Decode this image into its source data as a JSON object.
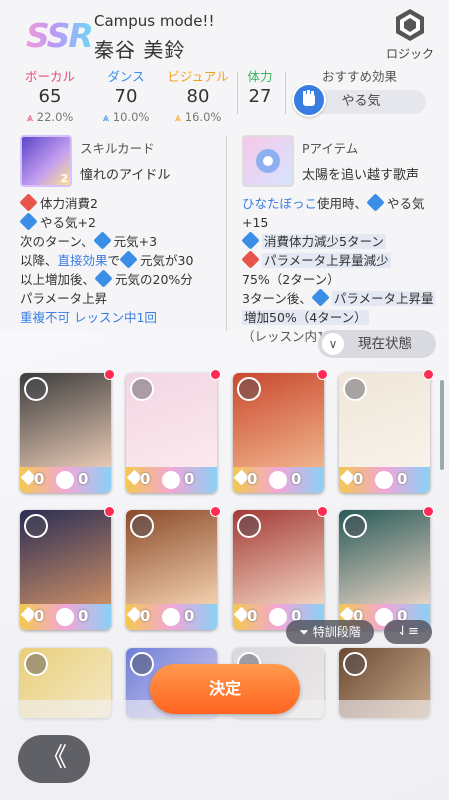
{
  "header": {
    "rarity": "SSR",
    "mode": "Campus mode!!",
    "name": "秦谷 美鈴",
    "logic_label": "ロジック"
  },
  "stats": [
    {
      "title": "ボーカル",
      "value": "65",
      "bonus": "22.0%",
      "color": "#e84a7a"
    },
    {
      "title": "ダンス",
      "value": "70",
      "bonus": "10.0%",
      "color": "#3a8ee6"
    },
    {
      "title": "ビジュアル",
      "value": "80",
      "bonus": "16.0%",
      "color": "#f2a21c"
    }
  ],
  "stamina": {
    "title": "体力",
    "value": "27",
    "color": "#3cb45a"
  },
  "recommended": {
    "title": "おすすめ効果",
    "value": "やる気"
  },
  "skill_card": {
    "section": "スキルカード",
    "name": "憧れのアイドル",
    "badge": "2",
    "lines": {
      "l1": "体力消費2",
      "l2": "やる気+2",
      "l3a": "次のターン、",
      "l3b": "元気+3",
      "l4a": "以降、",
      "l4b": "直接効果",
      "l4c": "で",
      "l4d": "元気が30",
      "l5a": "以上増加後、",
      "l5b": "元気の20%分",
      "l6": "パラメータ上昇",
      "l7": "重複不可 レッスン中1回"
    }
  },
  "p_item": {
    "section": "Pアイテム",
    "name": "太陽を追い越す歌声",
    "lines": {
      "l1a": "ひなたぼっこ",
      "l1b": "使用時、",
      "l1c": "やる気",
      "l2": "+15",
      "l3": "消費体力減少5ターン",
      "l4": "パラメータ上昇量減少",
      "l5": "75%（2ターン）",
      "l6a": "3ターン後、",
      "l6b": "パラメータ上昇量",
      "l7": "増加50%（4ターン）",
      "l8": "（レッスン内1回）"
    }
  },
  "status_button": "現在状態",
  "cards": [
    {
      "lv": "0",
      "lv2": "0",
      "art": [
        "#3b3b3b",
        "#e7c9b5"
      ]
    },
    {
      "lv": "0",
      "lv2": "0",
      "art": [
        "#f3d6e3",
        "#fbe9ee"
      ]
    },
    {
      "lv": "0",
      "lv2": "0",
      "art": [
        "#c9482e",
        "#f0b38c"
      ]
    },
    {
      "lv": "0",
      "lv2": "0",
      "art": [
        "#efe6d8",
        "#f8f2ea"
      ]
    },
    {
      "lv": "0",
      "lv2": "0",
      "art": [
        "#2a2d55",
        "#c98d66"
      ]
    },
    {
      "lv": "0",
      "lv2": "0",
      "art": [
        "#8a4a2a",
        "#f2cfae"
      ]
    },
    {
      "lv": "0",
      "lv2": "0",
      "art": [
        "#a33a36",
        "#f3d3c0"
      ]
    },
    {
      "lv": "0",
      "lv2": "0",
      "art": [
        "#285a58",
        "#e8d3c4"
      ]
    }
  ],
  "toolbar": {
    "training_stage": "特訓段階",
    "sort": "⇃≡"
  },
  "confirm_button": "決定",
  "back_button": "《"
}
